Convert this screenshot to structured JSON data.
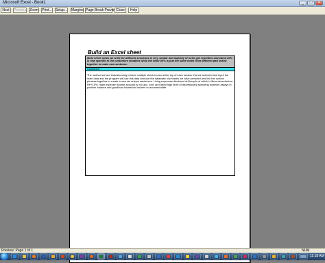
{
  "window": {
    "title": "Microsoft Excel - Book1"
  },
  "toolbar": {
    "buttons": [
      {
        "label": "Next",
        "enabled": true
      },
      {
        "label": "Previous",
        "enabled": false
      },
      {
        "label": "Zoom",
        "enabled": true
      },
      {
        "label": "Print...",
        "enabled": true
      },
      {
        "label": "Setup...",
        "enabled": true
      },
      {
        "label": "Margins",
        "enabled": true
      },
      {
        "label": "Page Break Preview",
        "enabled": true
      },
      {
        "label": "Close",
        "enabled": true
      },
      {
        "label": "Help",
        "enabled": true
      }
    ]
  },
  "sheet": {
    "title": "Build an Excel sheet",
    "header_text": "Most of the notes we write for different scenarios is very similar and majority of notes get repetitive and about 20% is new specific to the customers situation while the other 80% is just the same notes from different part linked together to make new sentence.",
    "highlight_text": "Combined",
    "body_text": "The method we are brainstorming is have multiple check boxes at the top of each section that we selected and input the main data and the program will use this data and use the database of phrases we have provided and link the correct phrases together to create a new set unique sentences. Living expenses disclosed at $xxxpfn of which is $xxx above/below HP+15%. main expense income account is xxx acc, xxxx and listed high level of discretionary spending however always in positive balance and good/bad household income to accommodate."
  },
  "statusbar": {
    "status": "Preview: Page 1 of 1",
    "num": "NUM"
  },
  "taskbar": {
    "clock": "11:18 AM"
  }
}
